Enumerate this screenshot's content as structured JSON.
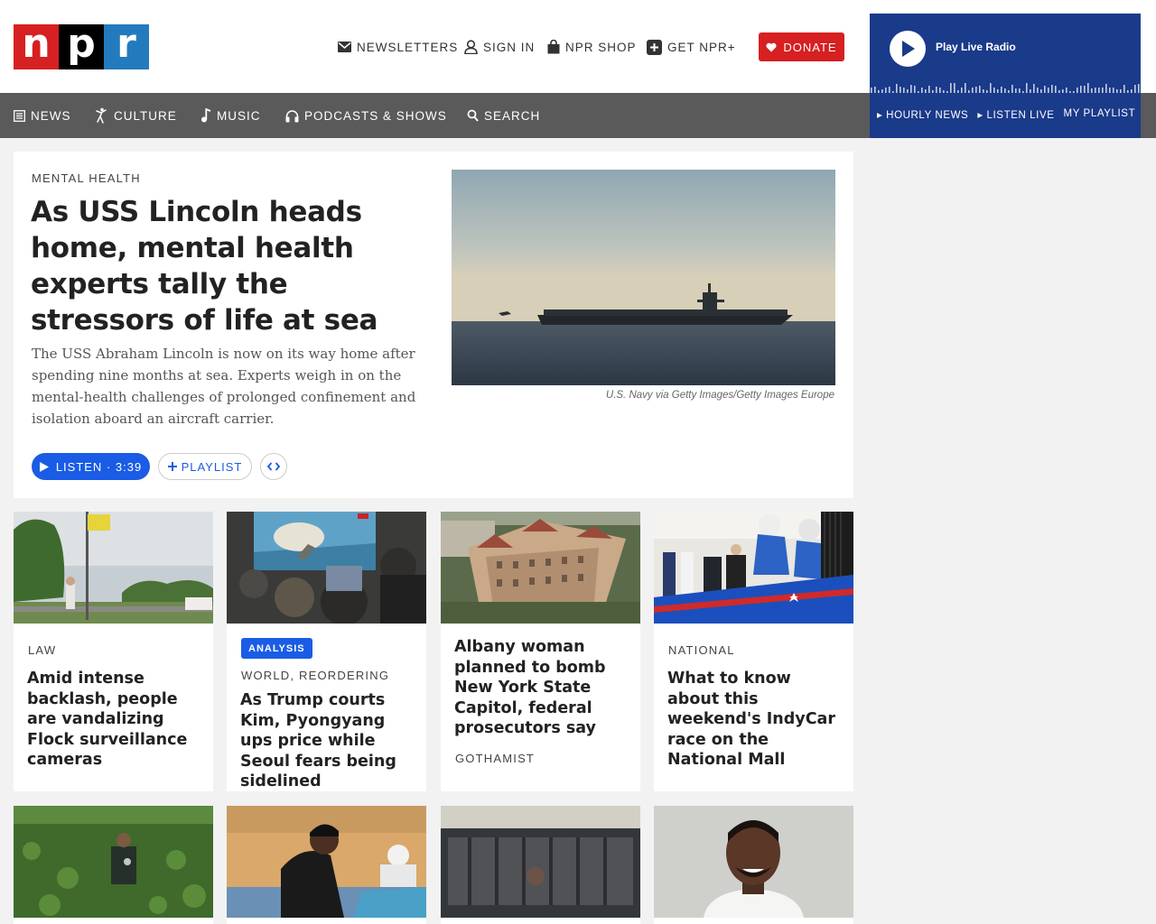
{
  "brand": {
    "logo_letters": [
      "n",
      "p",
      "r"
    ],
    "colors": {
      "red": "#d62021",
      "black": "#000000",
      "blue": "#237bbd",
      "accent": "#1a5ce5",
      "nav": "#5a5a5a",
      "radio": "#1a3a8a"
    }
  },
  "utility_nav": {
    "newsletters": "NEWSLETTERS",
    "sign_in": "SIGN IN",
    "shop": "NPR SHOP",
    "plus": "GET NPR+",
    "donate": "DONATE"
  },
  "main_nav": [
    {
      "label": "NEWS",
      "icon": "newspaper-icon"
    },
    {
      "label": "CULTURE",
      "icon": "dancer-icon"
    },
    {
      "label": "MUSIC",
      "icon": "music-note-icon"
    },
    {
      "label": "PODCASTS & SHOWS",
      "icon": "headphones-icon"
    },
    {
      "label": "SEARCH",
      "icon": "search-icon"
    }
  ],
  "live_radio": {
    "label": "Play Live Radio",
    "links": [
      "HOURLY NEWS",
      "LISTEN LIVE",
      "MY PLAYLIST"
    ]
  },
  "featured": {
    "slug": "MENTAL HEALTH",
    "headline": "As USS Lincoln heads home, mental health experts tally the stressors of life at sea",
    "teaser": "The USS Abraham Lincoln is now on its way home after spending nine months at sea. Experts weigh in on the mental-health challenges of prolonged confinement and isolation aboard an aircraft carrier.",
    "image_credit": "U.S. Navy via Getty Images/Getty Images Europe",
    "listen_label": "LISTEN · 3:39",
    "playlist_label": "PLAYLIST"
  },
  "stories": [
    {
      "badge": "",
      "slug": "LAW",
      "slug_position": "above",
      "headline": "Amid intense backlash, people are vandalizing Flock surveillance cameras"
    },
    {
      "badge": "ANALYSIS",
      "slug": "WORLD, REORDERING",
      "slug_position": "above",
      "headline": "As Trump courts Kim, Pyongyang ups price while Seoul fears being sidelined"
    },
    {
      "badge": "",
      "slug": "GOTHAMIST",
      "slug_position": "below",
      "headline": "Albany woman planned to bomb New York State Capitol, federal prosecutors say"
    },
    {
      "badge": "",
      "slug": "NATIONAL",
      "slug_position": "above",
      "headline": "What to know about this weekend's IndyCar race on the National Mall"
    }
  ]
}
